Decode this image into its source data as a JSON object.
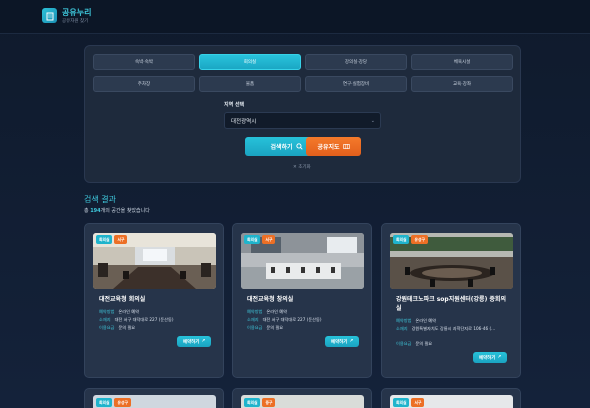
{
  "header": {
    "title": "공유누리",
    "subtitle": "공유자원 찾기"
  },
  "filters": {
    "categories": [
      {
        "label": "숙박·숙박",
        "active": false
      },
      {
        "label": "회의실",
        "active": true
      },
      {
        "label": "강의실·강당",
        "active": false
      },
      {
        "label": "체육시설",
        "active": false
      },
      {
        "label": "주차장",
        "active": false
      },
      {
        "label": "물품",
        "active": false
      },
      {
        "label": "연구·실험장비",
        "active": false
      },
      {
        "label": "교육·강좌",
        "active": false
      }
    ],
    "region_label": "지역 선택",
    "region_value": "대전광역시",
    "search_label": "검색하기",
    "map_label": "공유지도",
    "reset_label": "초기화"
  },
  "results": {
    "title": "검색 결과",
    "count_prefix": "총 ",
    "count": "194",
    "count_suffix": "개의 공간을 찾았습니다"
  },
  "cards": [
    {
      "badges": [
        "회의실",
        "서구"
      ],
      "title": "대전교육청 회의실",
      "rows": [
        {
          "k": "예약방법",
          "v": "온라인 예약"
        },
        {
          "k": "소재지",
          "v": "대전 서구 대덕대로 227 (둔산동)"
        },
        {
          "k": "이용요금",
          "v": "문의 필요"
        }
      ],
      "button": "예약하기"
    },
    {
      "badges": [
        "회의실",
        "서구"
      ],
      "title": "대전교육청 창의실",
      "rows": [
        {
          "k": "예약방법",
          "v": "온라인 예약"
        },
        {
          "k": "소재지",
          "v": "대전 서구 대덕대로 227 (둔산동)"
        },
        {
          "k": "이용요금",
          "v": "문의 필요"
        }
      ],
      "button": "예약하기"
    },
    {
      "badges": [
        "회의실",
        "유성구"
      ],
      "title": "강원테크노파크 sop지원센터(강릉) 중회의실",
      "rows": [
        {
          "k": "예약방법",
          "v": "온라인 예약"
        },
        {
          "k": "소재지",
          "v": "강원특별자치도 강릉시 과학단지로 106-46 (..."
        },
        {
          "k": "이용요금",
          "v": "문의 필요"
        }
      ],
      "button": "예약하기"
    }
  ],
  "cards_bottom": [
    {
      "badges": [
        "회의실",
        "유성구"
      ]
    },
    {
      "badges": [
        "회의실",
        "중구"
      ]
    },
    {
      "badges": [
        "회의실",
        "서구"
      ]
    }
  ],
  "colors": {
    "accent": "#29c3dc",
    "orange": "#ec6f25",
    "background": "#0f1a2c",
    "panel": "#1e2a3c"
  },
  "icons": {
    "logo": "building-icon",
    "search": "search-icon",
    "map": "map-icon",
    "reset": "close-icon",
    "external": "external-link-icon"
  }
}
